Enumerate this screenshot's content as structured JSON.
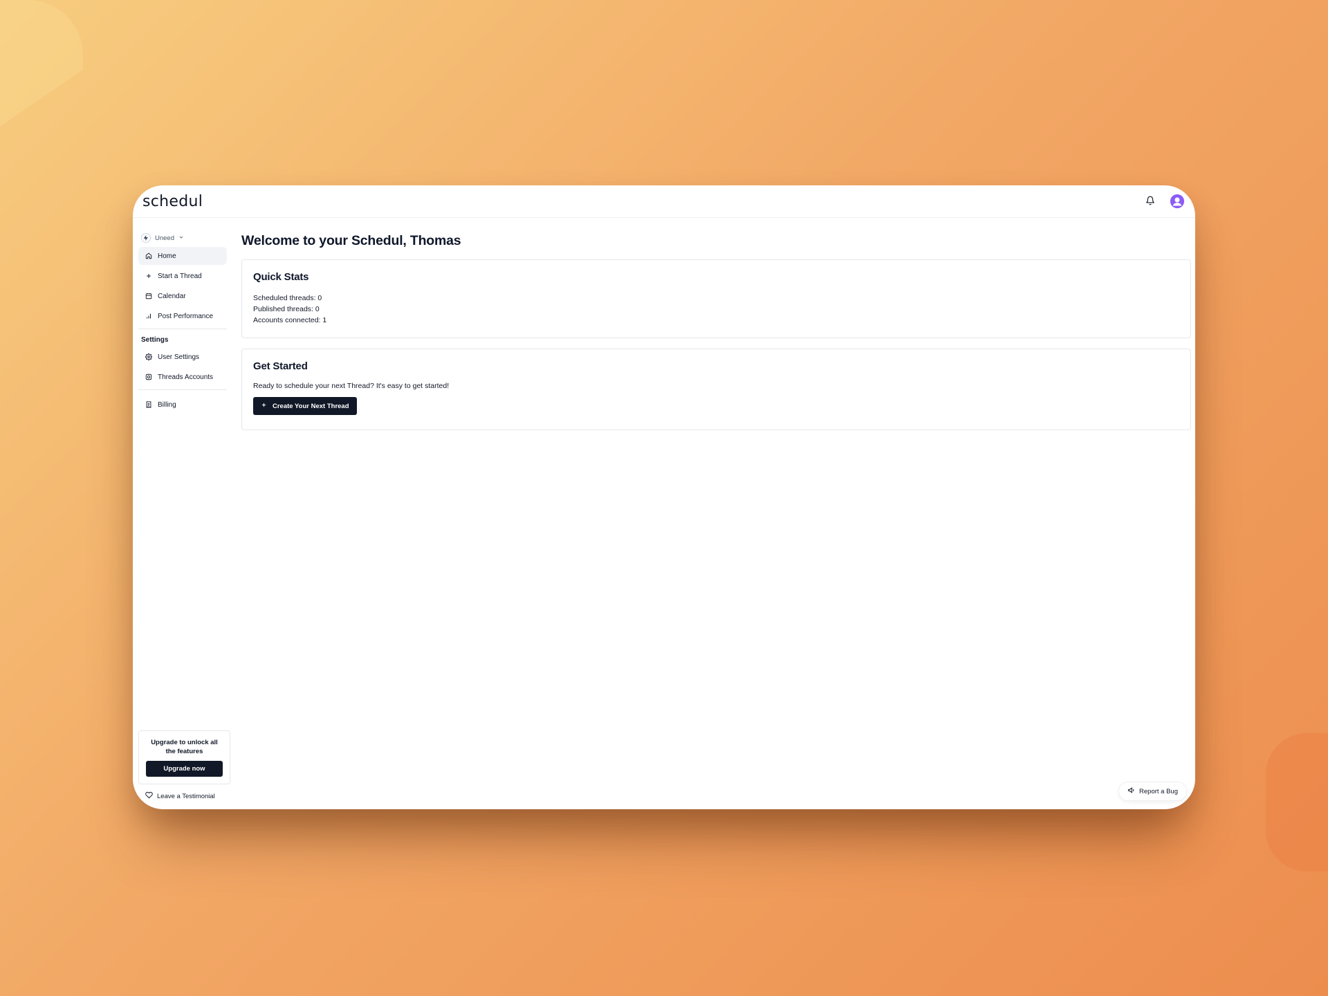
{
  "app": {
    "logo": "schedul"
  },
  "header": {
    "bell_icon": "bell-icon",
    "avatar_icon": "user-avatar"
  },
  "sidebar": {
    "workspace": "Uneed",
    "items": [
      {
        "label": "Home",
        "icon": "home-icon",
        "active": true
      },
      {
        "label": "Start a Thread",
        "icon": "plus-icon"
      },
      {
        "label": "Calendar",
        "icon": "calendar-icon"
      },
      {
        "label": "Post Performance",
        "icon": "bar-chart-icon"
      }
    ],
    "settings_label": "Settings",
    "settings_items": [
      {
        "label": "User Settings",
        "icon": "gear-icon"
      },
      {
        "label": "Threads Accounts",
        "icon": "instagram-icon"
      }
    ],
    "billing_item": {
      "label": "Billing",
      "icon": "receipt-icon"
    },
    "upgrade": {
      "text": "Upgrade to unlock all the features",
      "button": "Upgrade now"
    },
    "testimonial": "Leave a Testimonial"
  },
  "main": {
    "title": "Welcome to your Schedul, Thomas",
    "quick_stats": {
      "title": "Quick Stats",
      "lines": [
        "Scheduled threads: 0",
        "Published threads: 0",
        "Accounts connected: 1"
      ]
    },
    "get_started": {
      "title": "Get Started",
      "description": "Ready to schedule your next Thread? It's easy to get started!",
      "button": "Create Your Next Thread"
    }
  },
  "report_bug": "Report a Bug",
  "colors": {
    "accent_dark": "#111827",
    "avatar": "#7c3aed",
    "background_start": "#f7cd80",
    "background_end": "#ec8d4e"
  }
}
